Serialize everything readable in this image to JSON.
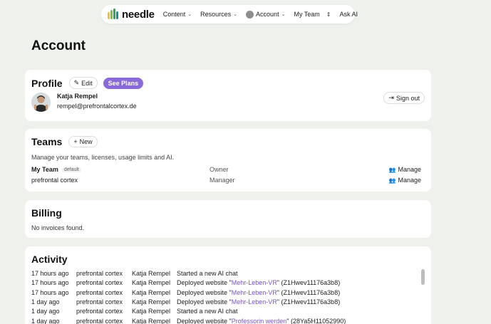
{
  "nav": {
    "brand": "needle",
    "items": [
      {
        "label": "Content"
      },
      {
        "label": "Resources"
      },
      {
        "label": "Account"
      },
      {
        "label": "My Team"
      },
      {
        "label": "Ask AI"
      }
    ]
  },
  "page": {
    "title": "Account"
  },
  "profile": {
    "heading": "Profile",
    "edit_label": "Edit",
    "plans_label": "See Plans",
    "name": "Katja Rempel",
    "email": "rempel@prefrontalcortex.de",
    "signout_label": "Sign out"
  },
  "teams": {
    "heading": "Teams",
    "new_label": "New",
    "description": "Manage your teams, licenses, usage limits and AI.",
    "rows": [
      {
        "name": "My Team",
        "badge": "default",
        "role": "Owner",
        "manage": "Manage"
      },
      {
        "name": "prefrontal cortex",
        "badge": "",
        "role": "Manager",
        "manage": "Manage"
      }
    ]
  },
  "billing": {
    "heading": "Billing",
    "empty": "No invoices found."
  },
  "activity": {
    "heading": "Activity",
    "rows": [
      {
        "time": "17 hours ago",
        "team": "prefrontal cortex",
        "user": "Katja Rempel",
        "event": "Started a new AI chat",
        "link": "",
        "suffix": ""
      },
      {
        "time": "17 hours ago",
        "team": "prefrontal cortex",
        "user": "Katja Rempel",
        "event": "Deployed website \"",
        "link": "Mehr-Leben-VR",
        "suffix": "\" (Z1Hwev11176a3b8)"
      },
      {
        "time": "17 hours ago",
        "team": "prefrontal cortex",
        "user": "Katja Rempel",
        "event": "Deployed website \"",
        "link": "Mehr-Leben-VR",
        "suffix": "\" (Z1Hwev11176a3b8)"
      },
      {
        "time": "1 day ago",
        "team": "prefrontal cortex",
        "user": "Katja Rempel",
        "event": "Deployed website \"",
        "link": "Mehr-Leben-VR",
        "suffix": "\" (Z1Hwev11176a3b8)"
      },
      {
        "time": "1 day ago",
        "team": "prefrontal cortex",
        "user": "Katja Rempel",
        "event": "Started a new AI chat",
        "link": "",
        "suffix": ""
      },
      {
        "time": "1 day ago",
        "team": "prefrontal cortex",
        "user": "Katja Rempel",
        "event": "Deployed website \"",
        "link": "Professorin werden",
        "suffix": "\" (28Ya5H11052990)"
      }
    ]
  },
  "colors": {
    "accent": "#8a6ad8",
    "link": "#7a52cc",
    "background": "#eef1ec"
  }
}
